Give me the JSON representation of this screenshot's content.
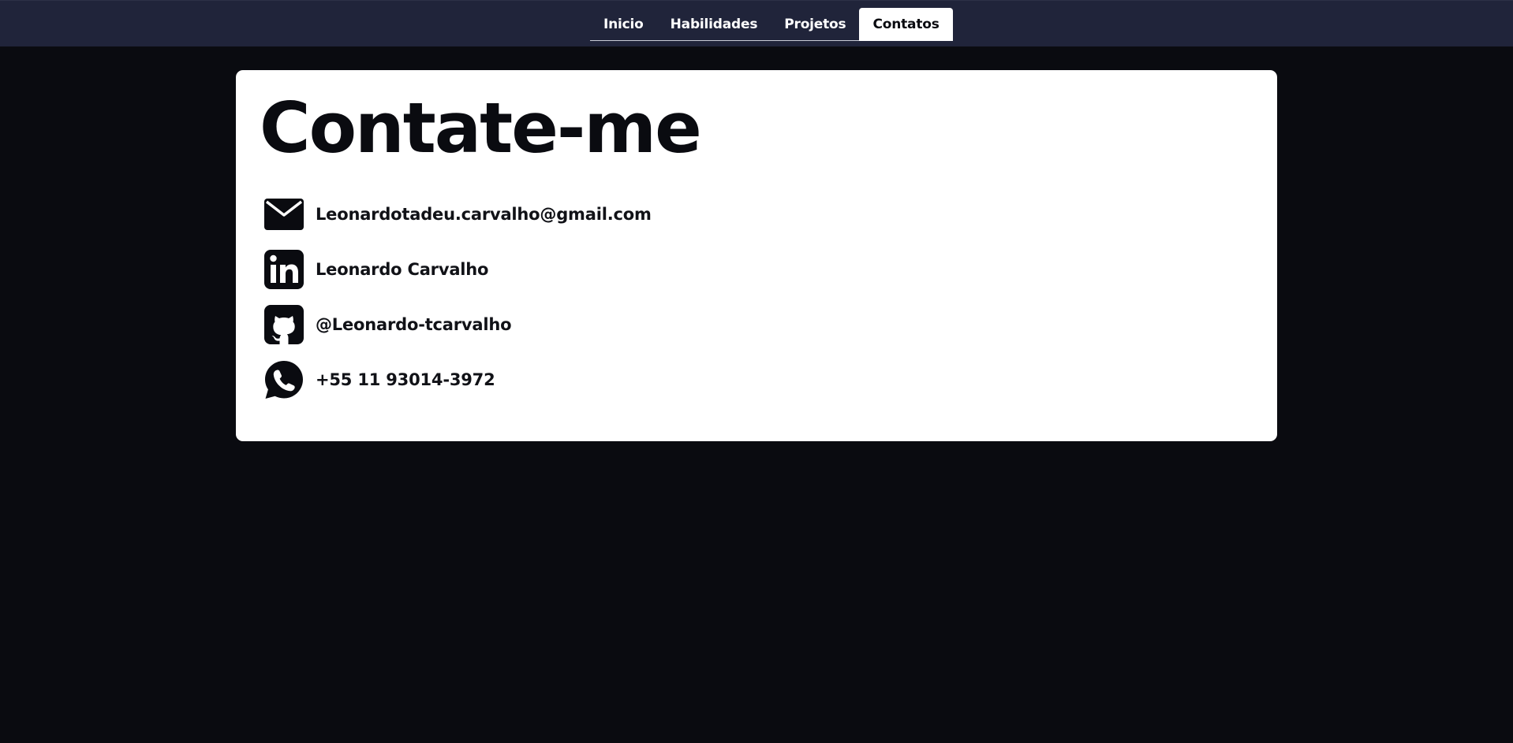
{
  "nav": {
    "items": [
      {
        "label": "Inicio"
      },
      {
        "label": "Habilidades"
      },
      {
        "label": "Projetos"
      },
      {
        "label": "Contatos"
      }
    ],
    "active": "Contatos"
  },
  "main": {
    "title": "Contate-me",
    "contacts": [
      {
        "icon": "envelope-icon",
        "label": "Leonardotadeu.carvalho@gmail.com"
      },
      {
        "icon": "linkedin-icon",
        "label": "Leonardo Carvalho"
      },
      {
        "icon": "github-icon",
        "label": "@Leonardo-tcarvalho"
      },
      {
        "icon": "whatsapp-icon",
        "label": "+55 11 93014-3972"
      }
    ]
  },
  "colors": {
    "page_background": "#0a0b10",
    "navbar_background": "#20243a",
    "card_background": "#ffffff",
    "text_dark": "#0a0b10"
  }
}
